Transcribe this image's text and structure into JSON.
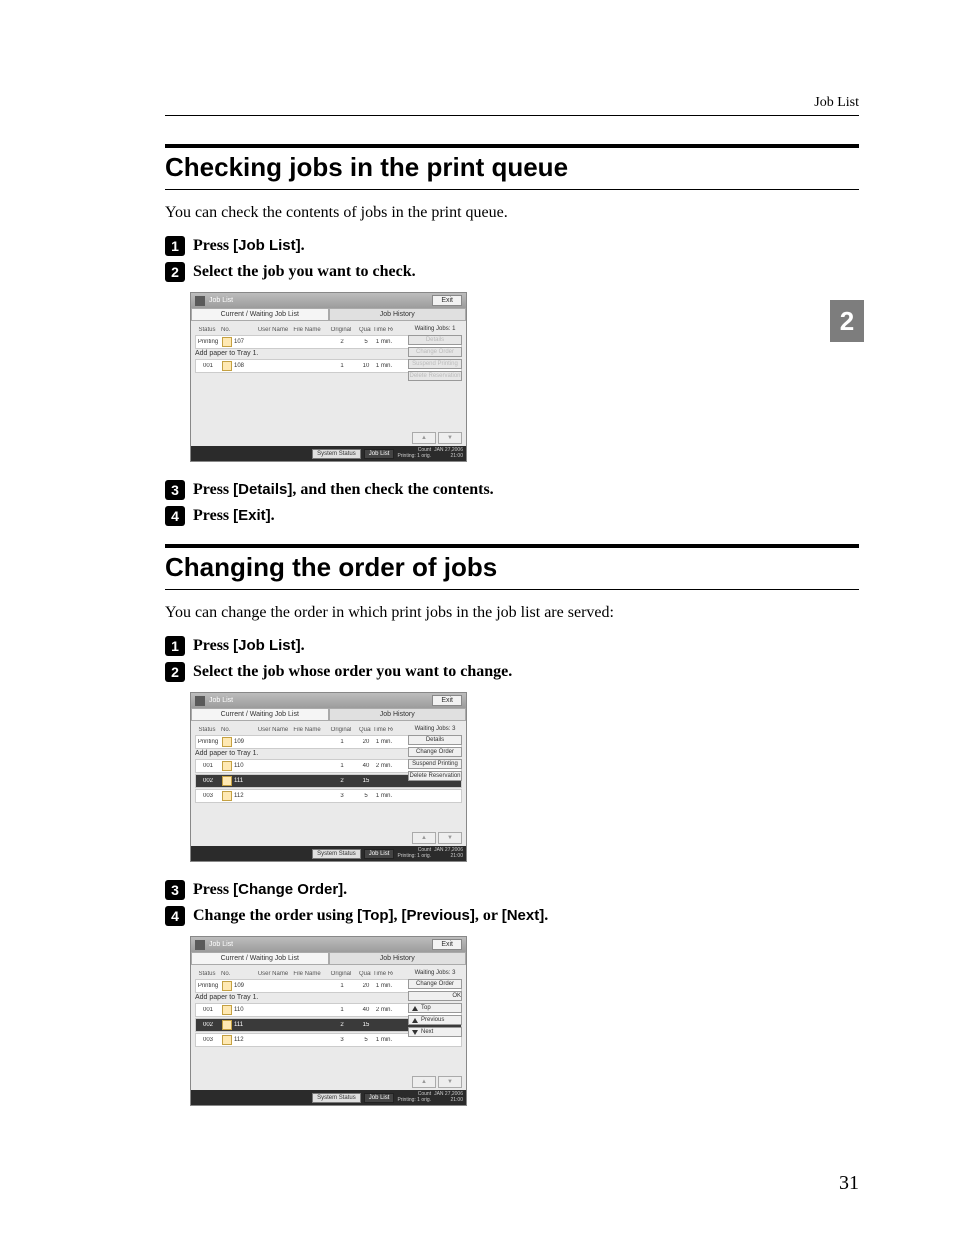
{
  "header": {
    "page_label": "Job List"
  },
  "side_tab": {
    "label": "2"
  },
  "section1": {
    "title": "Checking jobs in the print queue",
    "intro": "You can check the contents of jobs in the print queue.",
    "steps": {
      "s1": {
        "press": "Press ",
        "btn": "[Job List]",
        "dot": "."
      },
      "s2": {
        "text": "Select the job you want to check."
      },
      "s3": {
        "press": "Press ",
        "btn": "[Details]",
        "rest": ", and then check the contents."
      },
      "s4": {
        "press": "Press ",
        "btn": "[Exit]",
        "dot": "."
      }
    }
  },
  "section2": {
    "title": "Changing the order of jobs",
    "intro": "You can change the order in which print jobs in the job list are served:",
    "steps": {
      "s1": {
        "press": "Press ",
        "btn": "[Job List]",
        "dot": "."
      },
      "s2": {
        "text": "Select the job whose order you want to change."
      },
      "s3": {
        "press": "Press ",
        "btn": "[Change Order]",
        "dot": "."
      },
      "s4": {
        "text1": "Change the order using ",
        "btn1": "[Top]",
        "sep1": ", ",
        "btn2": "[Previous]",
        "sep2": ", or ",
        "btn3": "[Next]",
        "dot": "."
      }
    }
  },
  "page_number": "31",
  "shot_common": {
    "window_title": "Job List",
    "exit": "Exit",
    "tab_current": "Current / Waiting Job List",
    "tab_history": "Job History",
    "cols": {
      "status": "Status",
      "no": "No.",
      "user": "User Name",
      "file": "File Name",
      "orig": "Original",
      "qty": "Quantity",
      "time": "Time Required"
    },
    "waiting_label": "Waiting Jobs:",
    "instr": "Add paper to Tray 1.",
    "footer": {
      "system_status": "System Status",
      "job_list": "Job List",
      "count_lbl": "Count",
      "printing": "Printing: 1 orig.",
      "date": "JAN 27,2006",
      "time": "21:00"
    },
    "pager": {
      "prev": "▲",
      "next": "▼"
    }
  },
  "shot1": {
    "waiting_count": "1",
    "rows": [
      {
        "status": "Printing",
        "no": "107",
        "orig": "2",
        "qty": "5",
        "time": "1 min."
      },
      {
        "status": "001",
        "no": "108",
        "orig": "1",
        "qty": "10",
        "time": "1 min."
      }
    ],
    "btns": {
      "details": "Details",
      "change": "Change Order",
      "suspend": "Suspend Printing",
      "delete": "Delete Reservation"
    }
  },
  "shot2": {
    "waiting_count": "3",
    "rows": [
      {
        "status": "Printing",
        "no": "109",
        "orig": "1",
        "qty": "20",
        "time": "1 min."
      },
      {
        "status": "001",
        "no": "110",
        "orig": "1",
        "qty": "40",
        "time": "2 min."
      },
      {
        "status": "002",
        "no": "111",
        "orig": "2",
        "qty": "15"
      },
      {
        "status": "003",
        "no": "112",
        "orig": "3",
        "qty": "5",
        "time": "1 min."
      }
    ],
    "btns": {
      "details": "Details",
      "change": "Change Order",
      "suspend": "Suspend Printing",
      "delete": "Delete Reservation"
    }
  },
  "shot3": {
    "waiting_count": "3",
    "rows": [
      {
        "status": "Printing",
        "no": "109",
        "orig": "1",
        "qty": "20",
        "time": "1 min."
      },
      {
        "status": "001",
        "no": "110",
        "orig": "1",
        "qty": "40",
        "time": "2 min."
      },
      {
        "status": "002",
        "no": "111",
        "orig": "2",
        "qty": "15"
      },
      {
        "status": "003",
        "no": "112",
        "orig": "3",
        "qty": "5",
        "time": "1 min."
      }
    ],
    "panel": {
      "label": "Change Order",
      "ok": "OK",
      "top": "Top",
      "previous": "Previous",
      "next": "Next"
    }
  }
}
